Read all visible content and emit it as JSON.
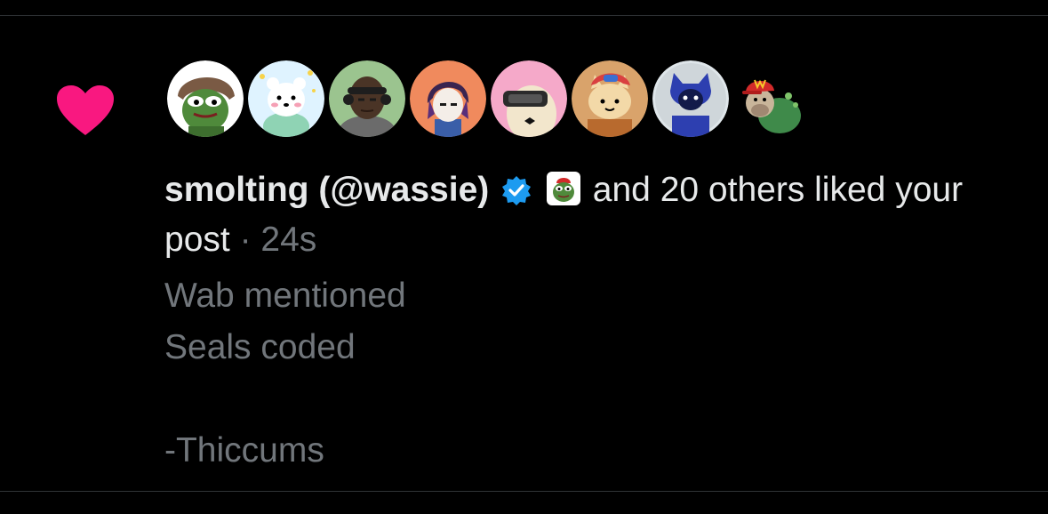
{
  "notification": {
    "type_icon": "heart-icon",
    "accent_color": "#f91880",
    "avatars": [
      {
        "name": "avatar-pepe-hood",
        "bg": "#ffffff"
      },
      {
        "name": "avatar-polar-bear",
        "bg": "#dff3ff"
      },
      {
        "name": "avatar-headphones-man",
        "bg": "#9bc48f"
      },
      {
        "name": "avatar-anime-purple-hair",
        "bg": "#f08a5d"
      },
      {
        "name": "avatar-vr-seal",
        "bg": "#f5a9c9"
      },
      {
        "name": "avatar-cat-cap",
        "bg": "#d9a36b"
      },
      {
        "name": "avatar-blue-bat",
        "bg": "#dfe6ea"
      },
      {
        "name": "avatar-bulldog-cap",
        "bg": "#000000"
      }
    ],
    "actor_name": "smolting (@wassie)",
    "verified_icon": "verified-badge-icon",
    "pepe_emoji_icon": "pepe-emoji-icon",
    "summary_rest": "and 20 others liked your post",
    "separator": "·",
    "time_ago": "24s",
    "post_text": "Wab mentioned\nSeals coded\n\n-Thiccums"
  }
}
